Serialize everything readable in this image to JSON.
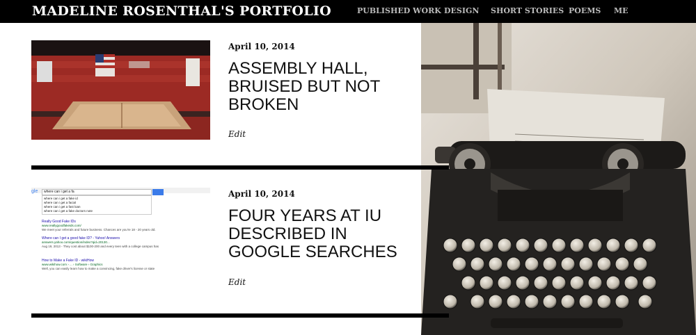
{
  "site": {
    "title": "MADELINE ROSENTHAL'S PORTFOLIO"
  },
  "nav": {
    "items": [
      {
        "label": "PUBLISHED WORK"
      },
      {
        "label": "DESIGN"
      },
      {
        "label": "SHORT STORIES"
      },
      {
        "label": "POEMS"
      },
      {
        "label": "ME"
      }
    ]
  },
  "posts": [
    {
      "date": "April 10, 2014",
      "title": "ASSEMBLY HALL, BRUISED BUT NOT BROKEN",
      "edit": "Edit"
    },
    {
      "date": "April 10, 2014",
      "title": "FOUR YEARS AT IU DESCRIBED IN GOOGLE SEARCHES",
      "edit": "Edit"
    }
  ],
  "thumb2": {
    "query": "where can i get a fa",
    "suggestions": [
      "where can i get a fake id",
      "where can i get a facial",
      "where can i get a fast loan",
      "where can i get a fake doctors note"
    ],
    "results": [
      {
        "title": "Really Good Fake IDs",
        "url": "www.reallygoodfakeids.com/",
        "snippet": "We meet your referrals and future business. Chances are you're 18 - 20 years old."
      },
      {
        "title": "Where can I get a good fake ID? - Yahoo! Answers",
        "url": "answers.yahoo.com/question/index?qid=20130...",
        "snippet": "Aug 19, 2013 - They cost about $100-200 and every teen with a college campus has"
      },
      {
        "title": "How to Make a Fake ID - wikiHow",
        "url": "www.wikihow.com › ... › Software › Graphics",
        "snippet": "Well, you can easily learn how to make a convincing, fake driver's license or state"
      }
    ]
  },
  "colors": {
    "header_bg": "#000000",
    "nav_text": "#bbbbbb",
    "divider": "#000000"
  }
}
